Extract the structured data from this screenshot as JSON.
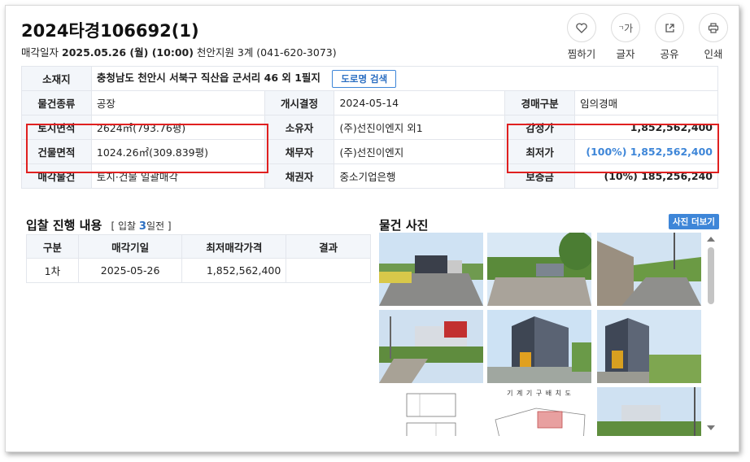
{
  "header": {
    "case_no": "2024타경106692(1)",
    "date_label": "매각일자",
    "date_value": "2025.05.26 (월) (10:00)",
    "court": "천안지원 3계 (041-620-3073)"
  },
  "actions": [
    {
      "label": "찜하기",
      "icon": "heart-icon"
    },
    {
      "label": "글자",
      "icon": "text-size-icon",
      "glyph": "가"
    },
    {
      "label": "공유",
      "icon": "share-icon"
    },
    {
      "label": "인쇄",
      "icon": "print-icon"
    }
  ],
  "info": {
    "address_label": "소재지",
    "address": "충청남도 천안시 서북구 직산읍 군서리 46 외 1필지",
    "road_btn": "도로명 검색",
    "rows": [
      {
        "l1": "물건종류",
        "v1": "공장",
        "l2": "개시결정",
        "v2": "2024-05-14",
        "l3": "경매구분",
        "v3": "임의경매"
      },
      {
        "l1": "토지면적",
        "v1": "2624㎡(793.76평)",
        "l2": "소유자",
        "v2": "(주)선진이엔지 외1",
        "l3": "감정가",
        "v3": "1,852,562,400"
      },
      {
        "l1": "건물면적",
        "v1": "1024.26㎡(309.839평)",
        "l2": "채무자",
        "v2": "(주)선진이엔지",
        "l3": "최저가",
        "v3": "(100%) 1,852,562,400"
      },
      {
        "l1": "매각물건",
        "v1": "토지·건물 일괄매각",
        "l2": "채권자",
        "v2": "중소기업은행",
        "l3": "보증금",
        "v3": "(10%) 185,256,240"
      }
    ]
  },
  "bid": {
    "title": "입찰 진행 내용",
    "sub_prefix": "[ 입찰",
    "sub_num": "3",
    "sub_suffix": "일전 ]",
    "headers": [
      "구분",
      "매각기일",
      "최저매각가격",
      "결과"
    ],
    "rows": [
      {
        "round": "1차",
        "date": "2025-05-26",
        "price": "1,852,562,400",
        "result": ""
      }
    ]
  },
  "photos": {
    "title": "물건 사진",
    "more": "사진 더보기",
    "drawing_caption": "기 계 기 구 배 치 도"
  },
  "colors": {
    "accent": "#3e86d8",
    "highlight": "#e02020",
    "header_bg": "#f3f6fa"
  }
}
